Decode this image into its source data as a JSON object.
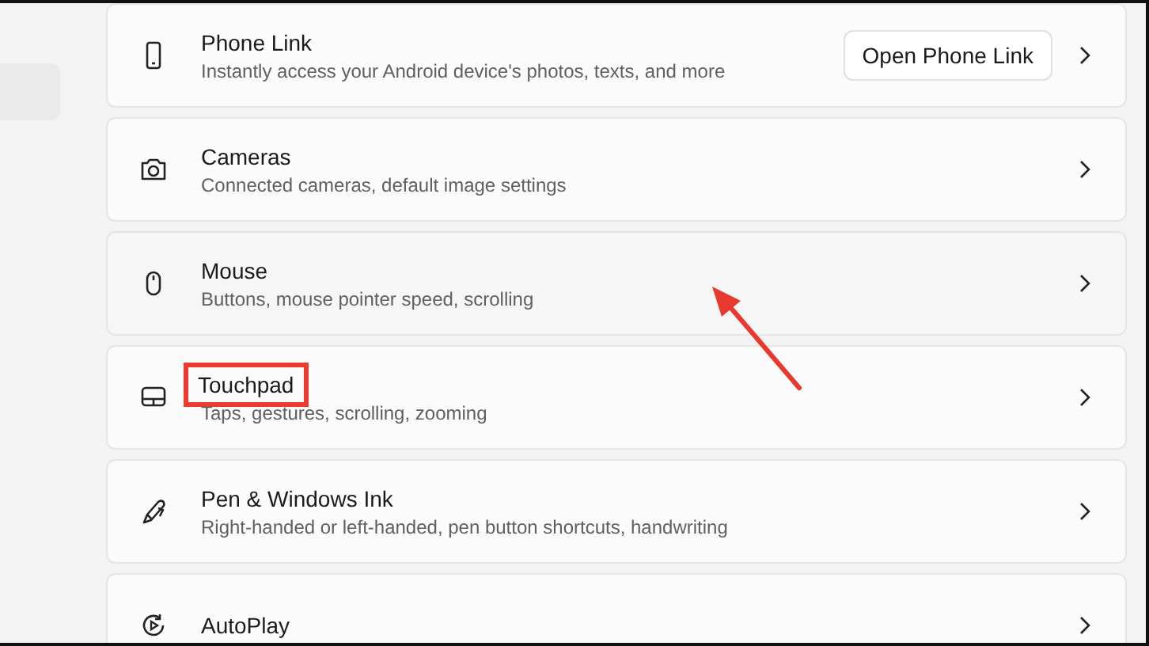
{
  "items": [
    {
      "title": "Phone Link",
      "description": "Instantly access your Android device's photos, texts, and more",
      "button": "Open Phone Link",
      "hovered": false,
      "highlighted": false
    },
    {
      "title": "Cameras",
      "description": "Connected cameras, default image settings",
      "hovered": false,
      "highlighted": false
    },
    {
      "title": "Mouse",
      "description": "Buttons, mouse pointer speed, scrolling",
      "hovered": true,
      "highlighted": false
    },
    {
      "title": "Touchpad",
      "description": "Taps, gestures, scrolling, zooming",
      "hovered": false,
      "highlighted": true
    },
    {
      "title": "Pen & Windows Ink",
      "description": "Right-handed or left-handed, pen button shortcuts, handwriting",
      "hovered": false,
      "highlighted": false
    },
    {
      "title": "AutoPlay",
      "hovered": false,
      "highlighted": false
    }
  ]
}
